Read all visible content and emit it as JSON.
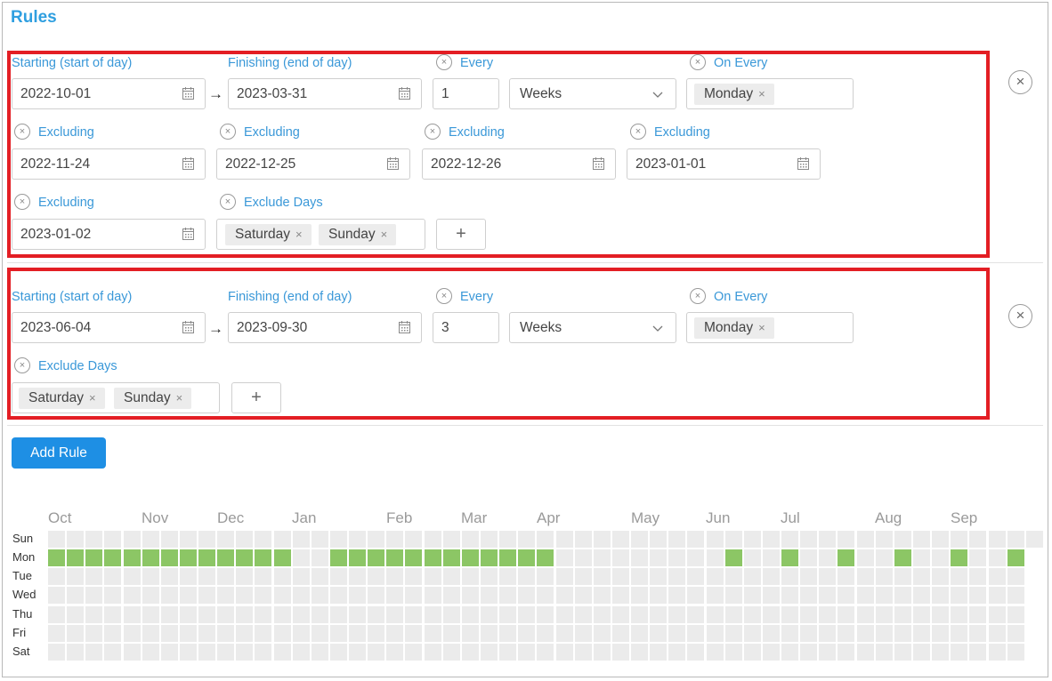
{
  "title": "Rules",
  "colors": {
    "accent": "#2f9fe0",
    "highlight": "#e31e24",
    "active_cell": "#8cc665",
    "inactive_cell": "#ebebeb",
    "button": "#1e8fe4"
  },
  "icons": {
    "calendar": "calendar-icon",
    "remove": "close-circle-icon",
    "dropdown": "chevron-down-icon",
    "add": "plus-icon"
  },
  "rule1": {
    "starting_label": "Starting (start of day)",
    "starting_value": "2022-10-01",
    "arrow": "→",
    "finishing_label": "Finishing (end of day)",
    "finishing_value": "2023-03-31",
    "every_label": "Every",
    "every_value": "1",
    "unit_value": "Weeks",
    "on_every_label": "On Every",
    "on_every_tags": [
      "Monday"
    ],
    "excluding": [
      {
        "label": "Excluding",
        "value": "2022-11-24"
      },
      {
        "label": "Excluding",
        "value": "2022-12-25"
      },
      {
        "label": "Excluding",
        "value": "2022-12-26"
      },
      {
        "label": "Excluding",
        "value": "2023-01-01"
      },
      {
        "label": "Excluding",
        "value": "2023-01-02"
      }
    ],
    "exclude_days_label": "Exclude Days",
    "exclude_days_tags": [
      "Saturday",
      "Sunday"
    ],
    "add_symbol": "+"
  },
  "rule2": {
    "starting_label": "Starting (start of day)",
    "starting_value": "2023-06-04",
    "arrow": "→",
    "finishing_label": "Finishing (end of day)",
    "finishing_value": "2023-09-30",
    "every_label": "Every",
    "every_value": "3",
    "unit_value": "Weeks",
    "on_every_label": "On Every",
    "on_every_tags": [
      "Monday"
    ],
    "exclude_days_label": "Exclude Days",
    "exclude_days_tags": [
      "Saturday",
      "Sunday"
    ],
    "add_symbol": "+"
  },
  "tag_remove_symbol": "×",
  "rule_remove_symbol": "×",
  "add_rule_label": "Add Rule",
  "heatmap": {
    "months": [
      "Oct",
      "Nov",
      "Dec",
      "Jan",
      "Feb",
      "Mar",
      "Apr",
      "May",
      "Jun",
      "Jul",
      "Aug",
      "Sep"
    ],
    "days": [
      "Sun",
      "Mon",
      "Tue",
      "Wed",
      "Thu",
      "Fri",
      "Sat"
    ],
    "weeks": 53,
    "active_mondays_week_index": [
      1,
      2,
      3,
      4,
      5,
      6,
      7,
      8,
      9,
      10,
      11,
      12,
      15,
      16,
      17,
      18,
      19,
      20,
      21,
      22,
      23,
      24,
      25,
      26,
      36,
      39,
      42,
      45,
      48,
      51
    ]
  }
}
